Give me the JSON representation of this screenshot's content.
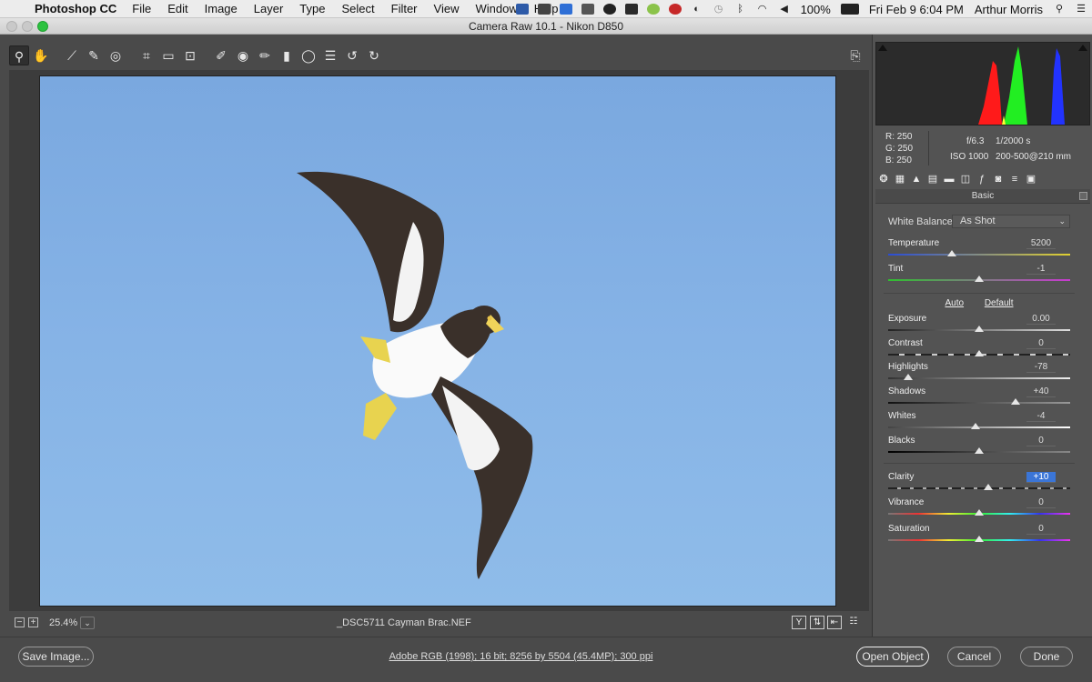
{
  "menubar": {
    "app_name": "Photoshop CC",
    "items": [
      "File",
      "Edit",
      "Image",
      "Layer",
      "Type",
      "Select",
      "Filter",
      "View",
      "Window",
      "Help"
    ],
    "battery": "100%",
    "datetime": "Fri Feb 9  6:04 PM",
    "user": "Arthur Morris"
  },
  "window": {
    "title": "Camera Raw 10.1  -  Nikon D850"
  },
  "toolbar": {
    "tools": [
      "zoom-icon",
      "hand-icon",
      "white-balance-icon",
      "color-sampler-icon",
      "targeted-adjustment-icon",
      "crop-icon",
      "straighten-icon",
      "transform-icon",
      "spot-removal-icon",
      "red-eye-icon",
      "adjustment-brush-icon",
      "graduated-filter-icon",
      "radial-filter-icon",
      "presets-list-icon",
      "rotate-ccw-icon",
      "rotate-cw-icon"
    ],
    "active_tool": "zoom-icon"
  },
  "preview": {
    "zoom_level": "25.4%",
    "filename": "_DSC5711  Cayman Brac.NEF"
  },
  "info": {
    "r_label": "R:",
    "r_value": "250",
    "g_label": "G:",
    "g_value": "250",
    "b_label": "B:",
    "b_value": "250",
    "aperture": "f/6.3",
    "shutter": "1/2000 s",
    "iso": "ISO 1000",
    "lens": "200-500@210 mm"
  },
  "panel": {
    "title": "Basic",
    "white_balance_label": "White Balance:",
    "white_balance_value": "As Shot",
    "auto_label": "Auto",
    "default_label": "Default",
    "sliders": [
      {
        "key": "temperature",
        "label": "Temperature",
        "value": "5200",
        "level": 0.35
      },
      {
        "key": "tint",
        "label": "Tint",
        "value": "-1",
        "level": 0.5
      },
      {
        "key": "exposure",
        "label": "Exposure",
        "value": "0.00",
        "level": 0.5
      },
      {
        "key": "contrast",
        "label": "Contrast",
        "value": "0",
        "level": 0.5
      },
      {
        "key": "highlights",
        "label": "Highlights",
        "value": "-78",
        "level": 0.11
      },
      {
        "key": "shadows",
        "label": "Shadows",
        "value": "+40",
        "level": 0.7
      },
      {
        "key": "whites",
        "label": "Whites",
        "value": "-4",
        "level": 0.48
      },
      {
        "key": "blacks",
        "label": "Blacks",
        "value": "0",
        "level": 0.5
      },
      {
        "key": "clarity",
        "label": "Clarity",
        "value": "+10",
        "level": 0.55
      },
      {
        "key": "vibrance",
        "label": "Vibrance",
        "value": "0",
        "level": 0.5
      },
      {
        "key": "saturation",
        "label": "Saturation",
        "value": "0",
        "level": 0.5
      }
    ]
  },
  "footer": {
    "save_label": "Save Image...",
    "workflow": "Adobe RGB (1998); 16 bit; 8256 by 5504 (45.4MP); 300 ppi",
    "open_label": "Open Object",
    "cancel_label": "Cancel",
    "done_label": "Done"
  },
  "colors": {
    "sky": "#85b2e5",
    "accent": "#3b75d6",
    "panel_bg": "#535353"
  }
}
